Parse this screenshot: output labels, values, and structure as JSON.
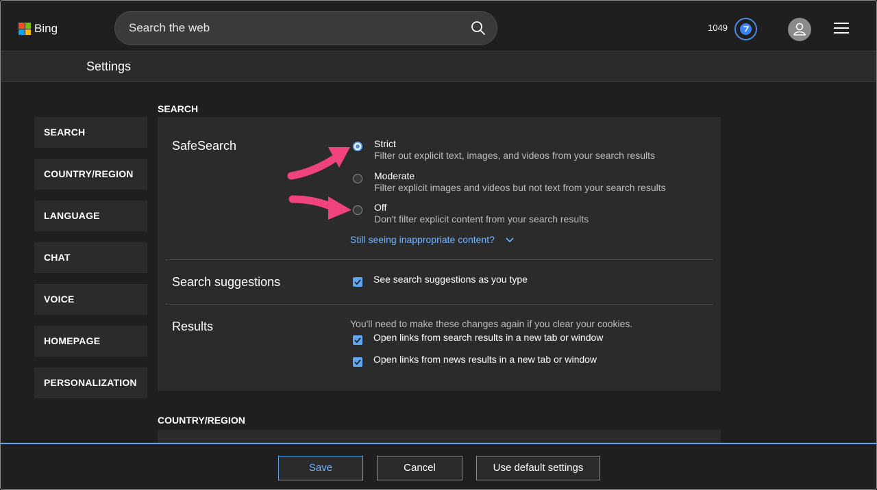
{
  "header": {
    "logo_text": "Bing",
    "search_placeholder": "Search the web",
    "points": "1049"
  },
  "settings_bar": {
    "title": "Settings"
  },
  "nav": {
    "items": [
      {
        "label": "SEARCH"
      },
      {
        "label": "COUNTRY/REGION"
      },
      {
        "label": "LANGUAGE"
      },
      {
        "label": "CHAT"
      },
      {
        "label": "VOICE"
      },
      {
        "label": "HOMEPAGE"
      },
      {
        "label": "PERSONALIZATION"
      }
    ]
  },
  "main": {
    "search_heading": "SEARCH",
    "country_heading": "COUNTRY/REGION",
    "safesearch": {
      "label": "SafeSearch",
      "selected": "Strict",
      "options": [
        {
          "title": "Strict",
          "desc": "Filter out explicit text, images, and videos from your search results"
        },
        {
          "title": "Moderate",
          "desc": "Filter explicit images and videos but not text from your search results"
        },
        {
          "title": "Off",
          "desc": "Don't filter explicit content from your search results"
        }
      ],
      "help_link": "Still seeing inappropriate content?"
    },
    "suggestions": {
      "label": "Search suggestions",
      "checkbox_label": "See search suggestions as you type",
      "checked": true
    },
    "results": {
      "label": "Results",
      "note": "You'll need to make these changes again if you clear your cookies.",
      "options": [
        {
          "label": "Open links from search results in a new tab or window",
          "checked": true
        },
        {
          "label": "Open links from news results in a new tab or window",
          "checked": true
        }
      ]
    }
  },
  "footer": {
    "save_label": "Save",
    "cancel_label": "Cancel",
    "default_label": "Use default settings"
  },
  "colors": {
    "accent": "#5ea6f3",
    "link": "#72b4ff",
    "annotation_arrow": "#f0437e",
    "background": "#1f1f1f",
    "panel": "#2b2b2b"
  }
}
